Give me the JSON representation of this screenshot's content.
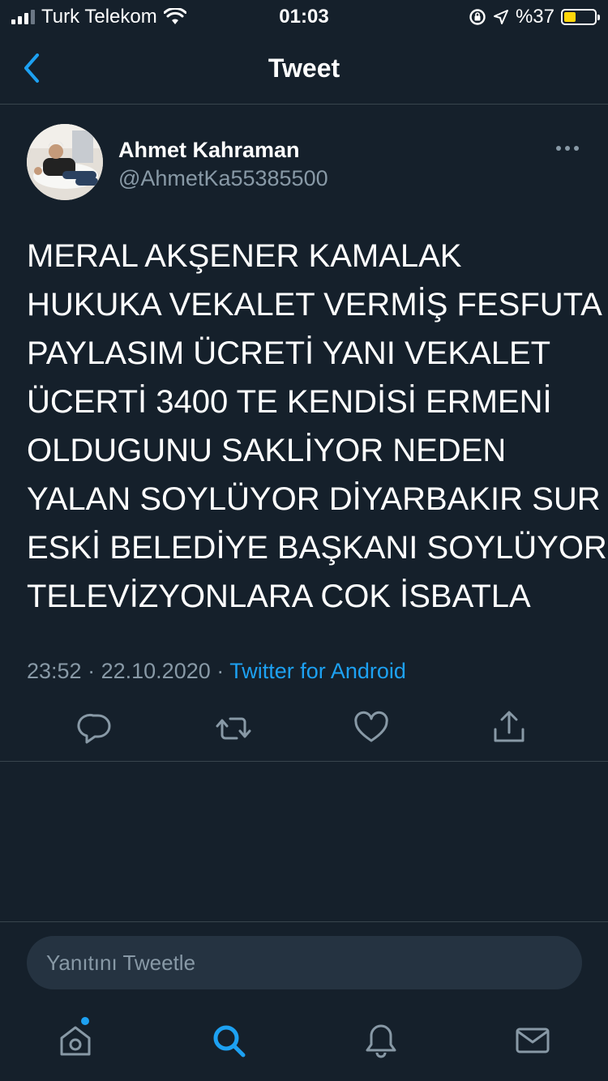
{
  "status_bar": {
    "carrier": "Turk Telekom",
    "time": "01:03",
    "battery": "%37"
  },
  "header": {
    "title": "Tweet"
  },
  "tweet": {
    "author_name": "Ahmet Kahraman",
    "author_handle": "@AhmetKa55385500",
    "text_lines": [
      "MERAL AKŞENER KAMALAK",
      "HUKUKA VEKALET VERMİŞ FESFUTA",
      "PAYLASIM ÜCRETİ YANI VEKALET",
      "ÜCERTİ 3400 TE  KENDİSİ ERMENİ",
      "OLDUGUNU SAKLİYOR NEDEN",
      "YALAN SOYLÜYOR DİYARBAKIR SUR",
      "ESKİ BELEDİYE BAŞKANI SOYLÜYOR",
      "TELEVİZYONLARA COK İSBATLA"
    ],
    "time": "23:52",
    "date": "22.10.2020",
    "separator": "·",
    "source": "Twitter for Android"
  },
  "reply": {
    "placeholder": "Yanıtını Tweetle"
  },
  "colors": {
    "background": "#15202b",
    "accent": "#1da1f2",
    "secondary_text": "#8899a6",
    "divider": "#38444d"
  }
}
